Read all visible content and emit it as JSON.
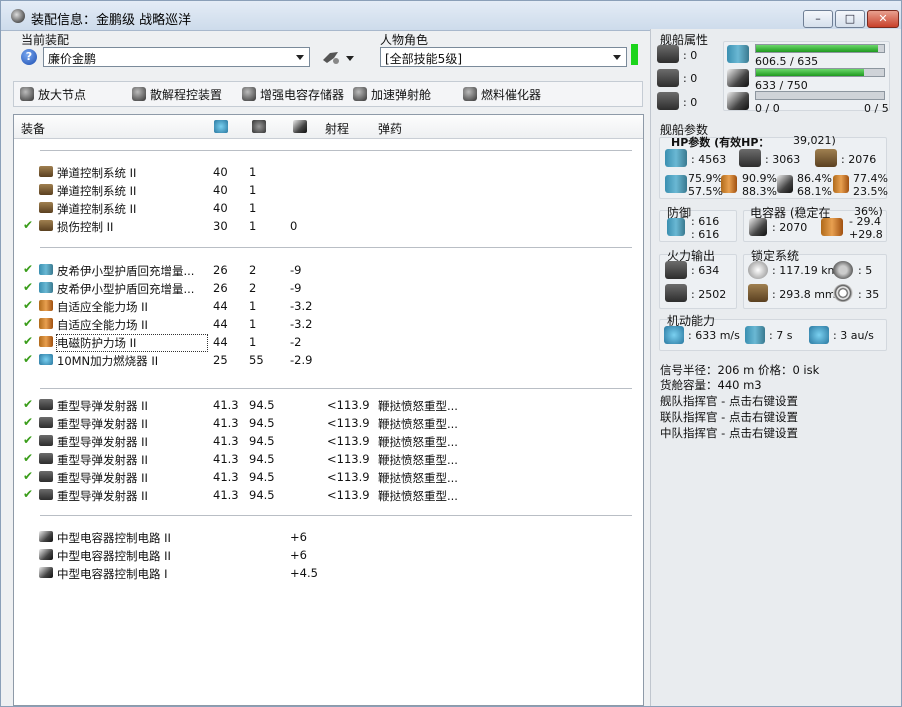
{
  "window": {
    "title": "装配信息：金鹏级 战略巡洋",
    "min": "–",
    "max": "□",
    "close": "✕"
  },
  "fitting": {
    "label": "当前装配",
    "value": "廉价金鹏"
  },
  "character": {
    "label": "人物角色",
    "value": "[全部技能5级]"
  },
  "toolbar": [
    "放大节点",
    "散解程控装置",
    "增强电容存储器",
    "加速弹射舱",
    "燃料催化器"
  ],
  "columns": {
    "equipment": "装备",
    "range": "射程",
    "ammo": "弹药"
  },
  "groups": [
    {
      "rows": [
        {
          "checked": false,
          "icon": "module",
          "name": "弹道控制系统 II",
          "c1": "40",
          "c2": "1",
          "c3": "",
          "c4": "",
          "c5": ""
        },
        {
          "checked": false,
          "icon": "module",
          "name": "弹道控制系统 II",
          "c1": "40",
          "c2": "1",
          "c3": "",
          "c4": "",
          "c5": ""
        },
        {
          "checked": false,
          "icon": "module",
          "name": "弹道控制系统 II",
          "c1": "40",
          "c2": "1",
          "c3": "",
          "c4": "",
          "c5": ""
        },
        {
          "checked": true,
          "icon": "module",
          "name": "损伤控制 II",
          "c1": "30",
          "c2": "1",
          "c3": "0",
          "c4": "",
          "c5": ""
        }
      ]
    },
    {
      "rows": [
        {
          "checked": true,
          "icon": "shield",
          "name": "皮希伊小型护盾回充增量...",
          "c1": "26",
          "c2": "2",
          "c3": "-9",
          "c4": "",
          "c5": ""
        },
        {
          "checked": true,
          "icon": "shield",
          "name": "皮希伊小型护盾回充增量...",
          "c1": "26",
          "c2": "2",
          "c3": "-9",
          "c4": "",
          "c5": ""
        },
        {
          "checked": true,
          "icon": "armor",
          "name": "自适应全能力场 II",
          "c1": "44",
          "c2": "1",
          "c3": "-3.2",
          "c4": "",
          "c5": ""
        },
        {
          "checked": true,
          "icon": "armor",
          "name": "自适应全能力场 II",
          "c1": "44",
          "c2": "1",
          "c3": "-3.2",
          "c4": "",
          "c5": ""
        },
        {
          "checked": true,
          "icon": "armor",
          "name": "电磁防护力场 II",
          "c1": "44",
          "c2": "1",
          "c3": "-2",
          "c4": "",
          "c5": "",
          "focus": true
        },
        {
          "checked": true,
          "icon": "ab",
          "name": "10MN加力燃烧器 II",
          "c1": "25",
          "c2": "55",
          "c3": "-2.9",
          "c4": "",
          "c5": ""
        }
      ]
    },
    {
      "rows": [
        {
          "checked": true,
          "icon": "launcher",
          "name": "重型导弹发射器 II",
          "c1": "41.3",
          "c2": "94.5",
          "c3": "",
          "c4": "<113.9",
          "c5": "鞭挞愤怒重型..."
        },
        {
          "checked": true,
          "icon": "launcher",
          "name": "重型导弹发射器 II",
          "c1": "41.3",
          "c2": "94.5",
          "c3": "",
          "c4": "<113.9",
          "c5": "鞭挞愤怒重型..."
        },
        {
          "checked": true,
          "icon": "launcher",
          "name": "重型导弹发射器 II",
          "c1": "41.3",
          "c2": "94.5",
          "c3": "",
          "c4": "<113.9",
          "c5": "鞭挞愤怒重型..."
        },
        {
          "checked": true,
          "icon": "launcher",
          "name": "重型导弹发射器 II",
          "c1": "41.3",
          "c2": "94.5",
          "c3": "",
          "c4": "<113.9",
          "c5": "鞭挞愤怒重型..."
        },
        {
          "checked": true,
          "icon": "launcher",
          "name": "重型导弹发射器 II",
          "c1": "41.3",
          "c2": "94.5",
          "c3": "",
          "c4": "<113.9",
          "c5": "鞭挞愤怒重型..."
        },
        {
          "checked": true,
          "icon": "launcher",
          "name": "重型导弹发射器 II",
          "c1": "41.3",
          "c2": "94.5",
          "c3": "",
          "c4": "<113.9",
          "c5": "鞭挞愤怒重型..."
        }
      ]
    },
    {
      "rows": [
        {
          "checked": false,
          "icon": "rig",
          "name": "中型电容器控制电路 II",
          "c1": "",
          "c2": "",
          "c3": "+6",
          "c4": "",
          "c5": ""
        },
        {
          "checked": false,
          "icon": "rig",
          "name": "中型电容器控制电路 II",
          "c1": "",
          "c2": "",
          "c3": "+6",
          "c4": "",
          "c5": ""
        },
        {
          "checked": false,
          "icon": "rig",
          "name": "中型电容器控制电路 I",
          "c1": "",
          "c2": "",
          "c3": "+4.5",
          "c4": "",
          "c5": ""
        }
      ]
    }
  ],
  "ship_attrs": {
    "title": "舰船属性",
    "hardpoints": [
      ": 0",
      ": 0",
      ": 0"
    ],
    "cpu": "606.5 / 635",
    "cpu_ratio": 0.955,
    "power": "633 / 750",
    "power_ratio": 0.844,
    "calib_left": "0 / 0",
    "calib_right": "0 / 5"
  },
  "ship_params": {
    "title": "舰船参数",
    "hp_label": "HP参数 (有效HP：",
    "ehp": "39,021)",
    "shield_hp": ": 4563",
    "armor_hp": ": 3063",
    "hull_hp": ": 2076",
    "resists": [
      [
        "75.9%",
        "57.5%"
      ],
      [
        "90.9%",
        "88.3%"
      ],
      [
        "86.4%",
        "68.1%"
      ],
      [
        "77.4%",
        "23.5%"
      ]
    ]
  },
  "defense": {
    "title": "防御",
    "v1": ": 616",
    "v2": ": 616"
  },
  "capacitor": {
    "title": "电容器 (稳定在",
    "pct": "36%)",
    "amount": ": 2070",
    "d1": "- 29.4",
    "d2": "+29.8"
  },
  "firepower": {
    "title": "火力输出",
    "dps": ": 634",
    "volley": ": 2502"
  },
  "targeting": {
    "title": "锁定系统",
    "range": ": 117.19 km",
    "targets": ": 5",
    "scan": ": 293.8 mm",
    "sensor": ": 35"
  },
  "mobility": {
    "title": "机动能力",
    "speed": ": 633 m/s",
    "align": ": 7 s",
    "warp": ": 3 au/s"
  },
  "misc": [
    "信号半径：206 m    价格：0 isk",
    "货舱容量：440 m3",
    "舰队指挥官 - 点击右键设置",
    "联队指挥官 - 点击右键设置",
    "中队指挥官 - 点击右键设置"
  ]
}
